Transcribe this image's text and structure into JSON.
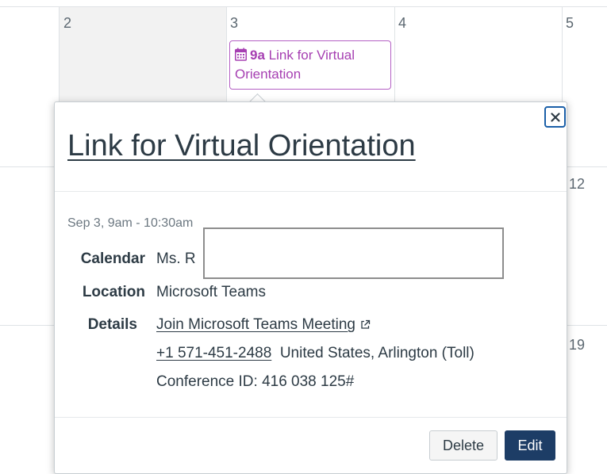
{
  "calendar": {
    "day_numbers": [
      "2",
      "3",
      "4",
      "5",
      "12",
      "19"
    ],
    "event_chip": {
      "icon": "calendar-icon",
      "time": "9a",
      "title": "Link for Virtual Orientation",
      "color": "#a63fb2"
    }
  },
  "popover": {
    "close_icon": "close-icon",
    "title": "Link for Virtual Orientation",
    "datetime": "Sep 3, 9am - 10:30am",
    "calendar_label": "Calendar",
    "calendar_value": "Ms. R",
    "location_label": "Location",
    "location_value": "Microsoft Teams",
    "details_label": "Details",
    "details_link": "Join Microsoft Teams Meeting",
    "details_link_icon": "external-link-icon",
    "phone_link": "+1 571-451-2488",
    "phone_region": "United States, Arlington (Toll)",
    "conference_id": "Conference ID: 416 038 125#",
    "delete_label": "Delete",
    "edit_label": "Edit",
    "edit_color": "#1d3d66"
  }
}
